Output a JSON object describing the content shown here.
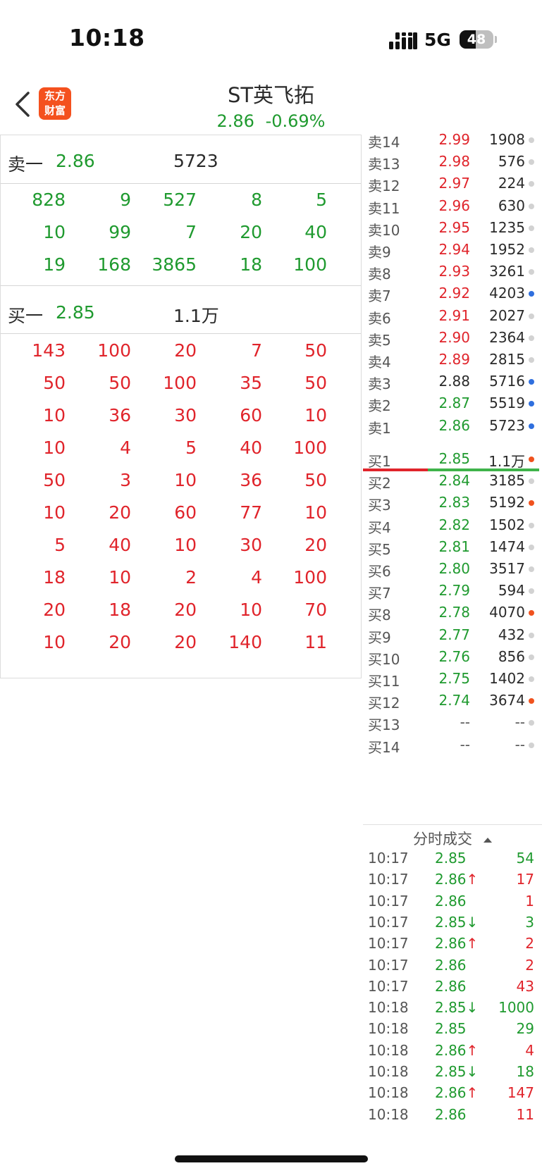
{
  "status_bar": {
    "time": "10:18",
    "network": "5G",
    "battery": "48",
    "battery_level": 0.48
  },
  "header": {
    "back_icon": "chevron-left-icon",
    "logo": {
      "line1": "东方",
      "line2": "财富",
      "color": "#f4511e"
    },
    "title": "ST英飞拓",
    "price": "2.86",
    "change": "-0.69%"
  },
  "colors": {
    "up": "#e0242b",
    "down": "#1f9a2f",
    "dot_blue": "#2f6fde",
    "dot_orange": "#f0521e",
    "dot_gray": "#d2d2d2"
  },
  "left_panel": {
    "sell_one": {
      "label": "卖一",
      "price": "2.86",
      "volume": "5723"
    },
    "sell_queue": [
      [
        "828",
        "9",
        "527",
        "8",
        "5"
      ],
      [
        "10",
        "99",
        "7",
        "20",
        "40"
      ],
      [
        "19",
        "168",
        "3865",
        "18",
        "100"
      ]
    ],
    "buy_one": {
      "label": "买一",
      "price": "2.85",
      "volume": "1.1万"
    },
    "buy_queue": [
      [
        "143",
        "100",
        "20",
        "7",
        "50"
      ],
      [
        "50",
        "50",
        "100",
        "35",
        "50"
      ],
      [
        "10",
        "36",
        "30",
        "60",
        "10"
      ],
      [
        "10",
        "4",
        "5",
        "40",
        "100"
      ],
      [
        "50",
        "3",
        "10",
        "36",
        "50"
      ],
      [
        "10",
        "20",
        "60",
        "77",
        "10"
      ],
      [
        "5",
        "40",
        "10",
        "30",
        "20"
      ],
      [
        "18",
        "10",
        "2",
        "4",
        "100"
      ],
      [
        "20",
        "18",
        "20",
        "10",
        "70"
      ],
      [
        "10",
        "20",
        "20",
        "140",
        "11"
      ]
    ]
  },
  "order_book": {
    "asks": [
      {
        "label": "卖14",
        "price": "2.99",
        "vol": "1908",
        "color": "red",
        "dot": "gray"
      },
      {
        "label": "卖13",
        "price": "2.98",
        "vol": "576",
        "color": "red",
        "dot": "gray"
      },
      {
        "label": "卖12",
        "price": "2.97",
        "vol": "224",
        "color": "red",
        "dot": "gray"
      },
      {
        "label": "卖11",
        "price": "2.96",
        "vol": "630",
        "color": "red",
        "dot": "gray"
      },
      {
        "label": "卖10",
        "price": "2.95",
        "vol": "1235",
        "color": "red",
        "dot": "gray"
      },
      {
        "label": "卖9",
        "price": "2.94",
        "vol": "1952",
        "color": "red",
        "dot": "gray"
      },
      {
        "label": "卖8",
        "price": "2.93",
        "vol": "3261",
        "color": "red",
        "dot": "gray"
      },
      {
        "label": "卖7",
        "price": "2.92",
        "vol": "4203",
        "color": "red",
        "dot": "blue"
      },
      {
        "label": "卖6",
        "price": "2.91",
        "vol": "2027",
        "color": "red",
        "dot": "gray"
      },
      {
        "label": "卖5",
        "price": "2.90",
        "vol": "2364",
        "color": "red",
        "dot": "gray"
      },
      {
        "label": "卖4",
        "price": "2.89",
        "vol": "2815",
        "color": "red",
        "dot": "gray"
      },
      {
        "label": "卖3",
        "price": "2.88",
        "vol": "5716",
        "color": "dark",
        "dot": "blue"
      },
      {
        "label": "卖2",
        "price": "2.87",
        "vol": "5519",
        "color": "green",
        "dot": "blue"
      },
      {
        "label": "卖1",
        "price": "2.86",
        "vol": "5723",
        "color": "green",
        "dot": "blue"
      }
    ],
    "bids": [
      {
        "label": "买1",
        "price": "2.85",
        "vol": "1.1万",
        "color": "green",
        "dot": "orange"
      },
      {
        "label": "买2",
        "price": "2.84",
        "vol": "3185",
        "color": "green",
        "dot": "gray"
      },
      {
        "label": "买3",
        "price": "2.83",
        "vol": "5192",
        "color": "green",
        "dot": "orange"
      },
      {
        "label": "买4",
        "price": "2.82",
        "vol": "1502",
        "color": "green",
        "dot": "gray"
      },
      {
        "label": "买5",
        "price": "2.81",
        "vol": "1474",
        "color": "green",
        "dot": "gray"
      },
      {
        "label": "买6",
        "price": "2.80",
        "vol": "3517",
        "color": "green",
        "dot": "gray"
      },
      {
        "label": "买7",
        "price": "2.79",
        "vol": "594",
        "color": "green",
        "dot": "gray"
      },
      {
        "label": "买8",
        "price": "2.78",
        "vol": "4070",
        "color": "green",
        "dot": "orange"
      },
      {
        "label": "买9",
        "price": "2.77",
        "vol": "432",
        "color": "green",
        "dot": "gray"
      },
      {
        "label": "买10",
        "price": "2.76",
        "vol": "856",
        "color": "green",
        "dot": "gray"
      },
      {
        "label": "买11",
        "price": "2.75",
        "vol": "1402",
        "color": "green",
        "dot": "gray"
      },
      {
        "label": "买12",
        "price": "2.74",
        "vol": "3674",
        "color": "green",
        "dot": "orange"
      },
      {
        "label": "买13",
        "price": "--",
        "vol": "--",
        "color": "gray",
        "dot": "gray"
      },
      {
        "label": "买14",
        "price": "--",
        "vol": "--",
        "color": "gray",
        "dot": "gray"
      }
    ]
  },
  "trades": {
    "title": "分时成交",
    "sort_icon": "triangle-up-icon",
    "rows": [
      {
        "time": "10:17",
        "price": "2.85",
        "arrow": "",
        "vol": "54",
        "vol_color": "green"
      },
      {
        "time": "10:17",
        "price": "2.86",
        "arrow": "↑",
        "vol": "17",
        "vol_color": "red"
      },
      {
        "time": "10:17",
        "price": "2.86",
        "arrow": "",
        "vol": "1",
        "vol_color": "red"
      },
      {
        "time": "10:17",
        "price": "2.85",
        "arrow": "↓",
        "vol": "3",
        "vol_color": "green"
      },
      {
        "time": "10:17",
        "price": "2.86",
        "arrow": "↑",
        "vol": "2",
        "vol_color": "red"
      },
      {
        "time": "10:17",
        "price": "2.86",
        "arrow": "",
        "vol": "2",
        "vol_color": "red"
      },
      {
        "time": "10:17",
        "price": "2.86",
        "arrow": "",
        "vol": "43",
        "vol_color": "red"
      },
      {
        "time": "10:18",
        "price": "2.85",
        "arrow": "↓",
        "vol": "1000",
        "vol_color": "green"
      },
      {
        "time": "10:18",
        "price": "2.85",
        "arrow": "",
        "vol": "29",
        "vol_color": "green"
      },
      {
        "time": "10:18",
        "price": "2.86",
        "arrow": "↑",
        "vol": "4",
        "vol_color": "red"
      },
      {
        "time": "10:18",
        "price": "2.85",
        "arrow": "↓",
        "vol": "18",
        "vol_color": "green"
      },
      {
        "time": "10:18",
        "price": "2.86",
        "arrow": "↑",
        "vol": "147",
        "vol_color": "red"
      },
      {
        "time": "10:18",
        "price": "2.86",
        "arrow": "",
        "vol": "11",
        "vol_color": "red"
      }
    ]
  }
}
